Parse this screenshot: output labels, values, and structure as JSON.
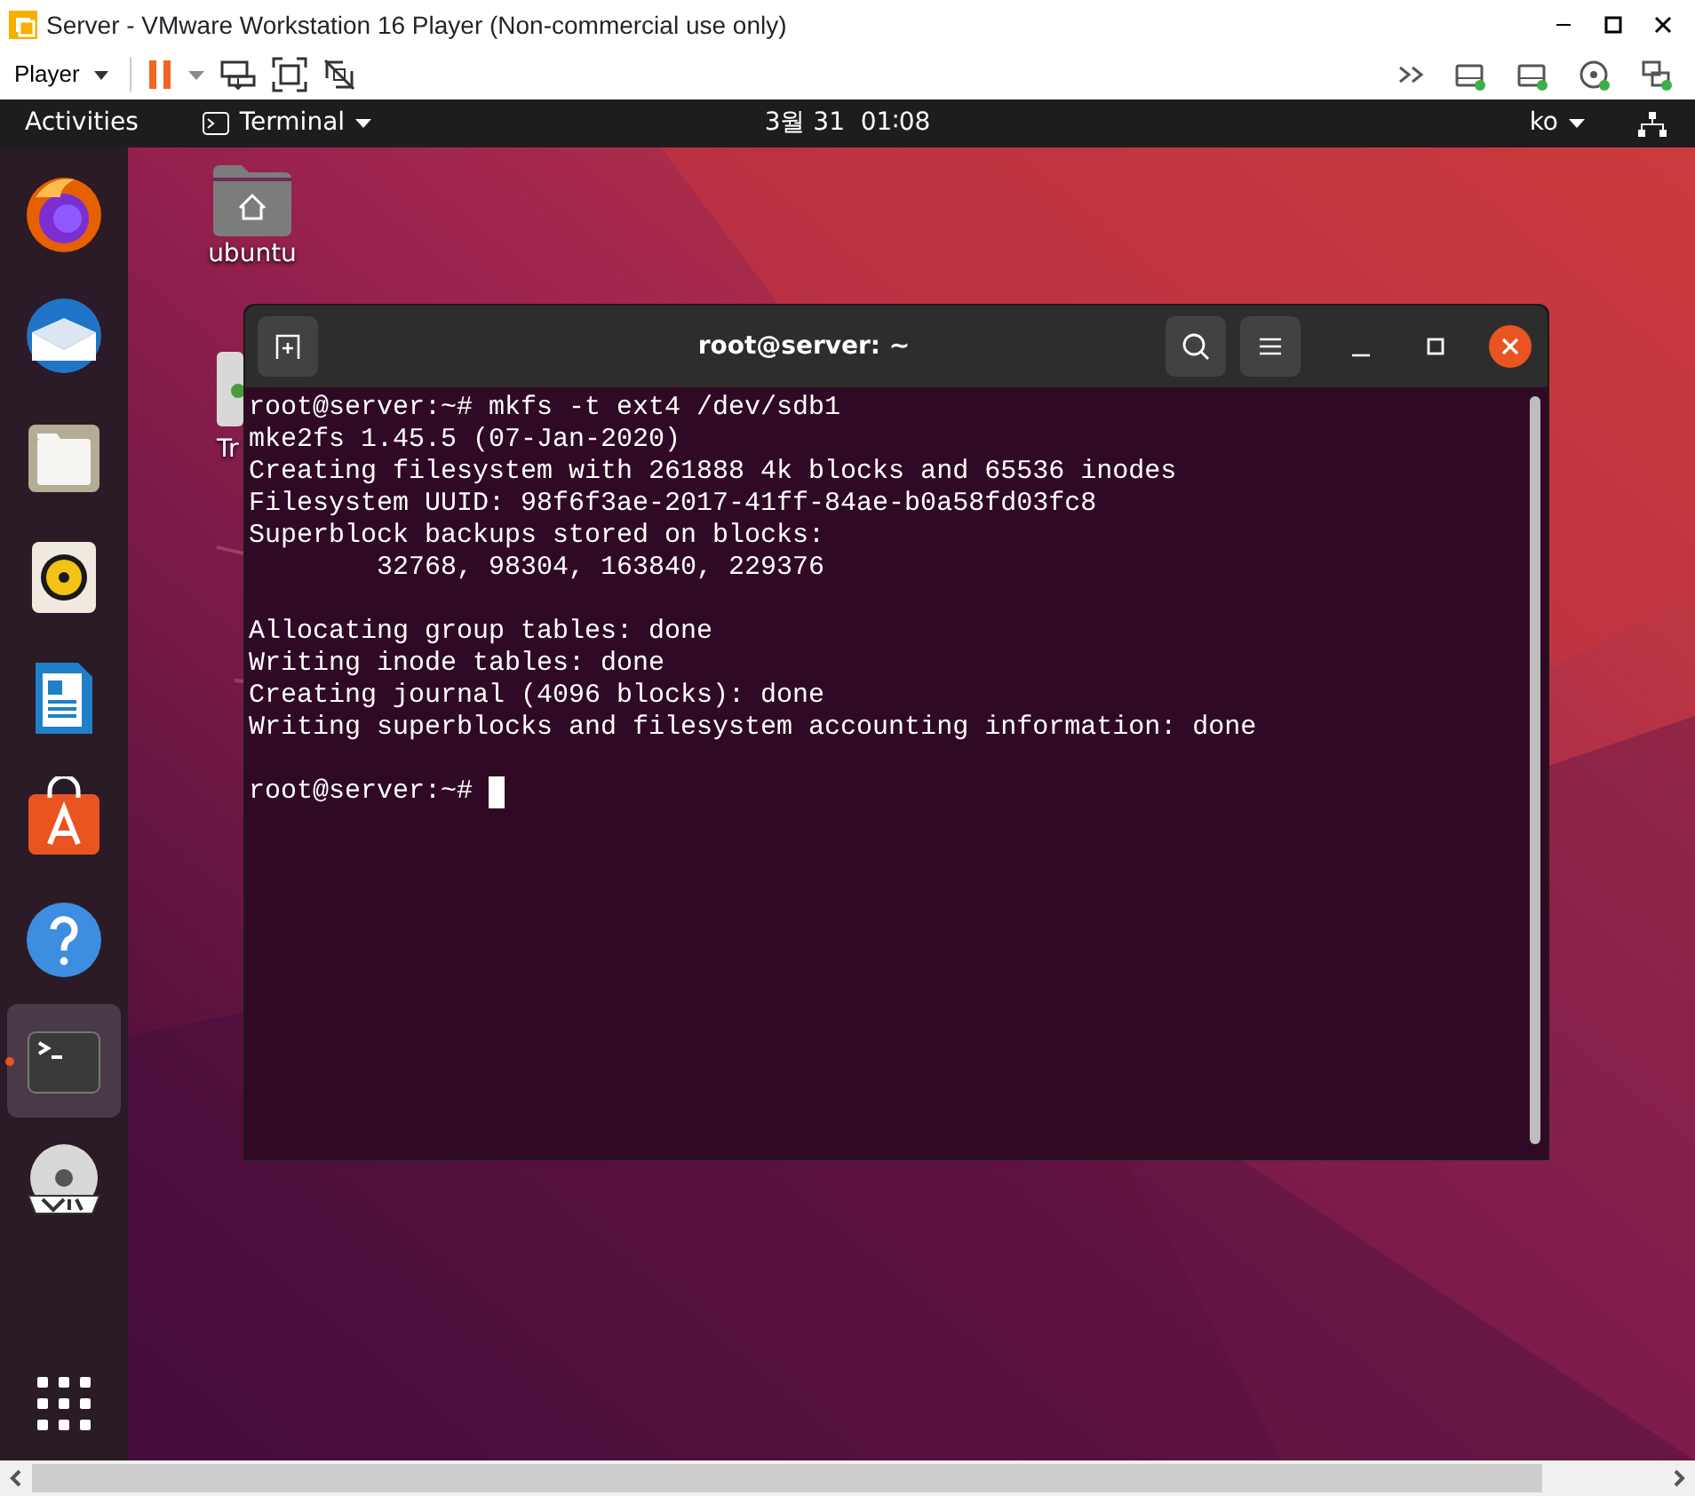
{
  "vm_window": {
    "title": "Server - VMware Workstation 16 Player (Non-commercial use only)"
  },
  "vm_toolbar": {
    "player_menu": "Player"
  },
  "top_bar": {
    "activities": "Activities",
    "app_menu": "Terminal",
    "clock": "3월 31  01∶08",
    "input_method": "ko"
  },
  "desktop_icons": [
    {
      "label": "ubuntu"
    },
    {
      "label": "Tr"
    }
  ],
  "dock": [
    {
      "running": false,
      "focused": false
    },
    {
      "running": false,
      "focused": false
    },
    {
      "running": false,
      "focused": false
    },
    {
      "running": false,
      "focused": false
    },
    {
      "running": false,
      "focused": false
    },
    {
      "running": false,
      "focused": false
    },
    {
      "running": false,
      "focused": false
    },
    {
      "running": true,
      "focused": true
    },
    {
      "running": false,
      "focused": false
    }
  ],
  "terminal": {
    "title": "root@server: ~",
    "cursor": true,
    "blocks": [
      [
        "root@server:~# mkfs -t ext4 /dev/sdb1",
        "mke2fs 1.45.5 (07-Jan-2020)",
        "Creating filesystem with 261888 4k blocks and 65536 inodes",
        "Filesystem UUID: 98f6f3ae-2017-41ff-84ae-b0a58fd03fc8",
        "Superblock backups stored on blocks:",
        "        32768, 98304, 163840, 229376"
      ],
      [
        "Allocating group tables: done",
        "Writing inode tables: done",
        "Creating journal (4096 blocks): done",
        "Writing superblocks and filesystem accounting information: done"
      ],
      [
        "root@server:~# "
      ]
    ]
  }
}
